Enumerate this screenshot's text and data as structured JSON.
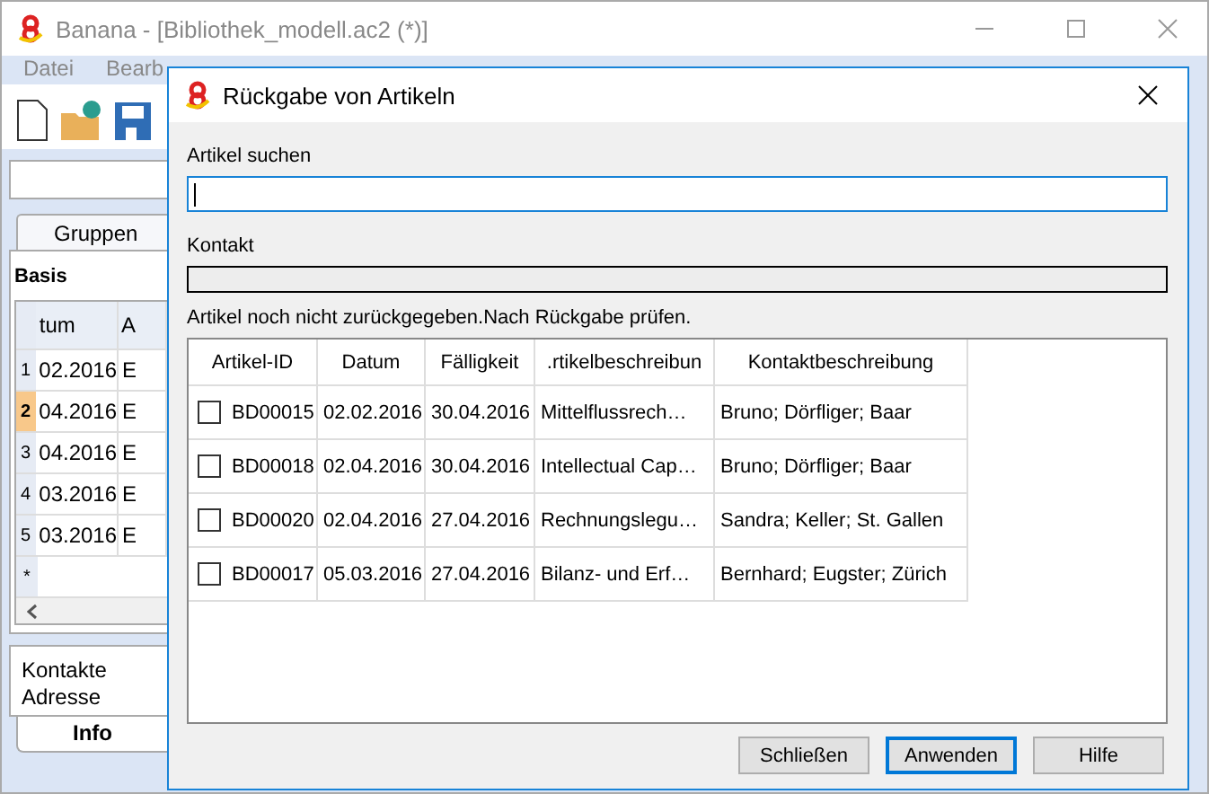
{
  "window": {
    "title": "Banana - [Bibliothek_modell.ac2 (*)]"
  },
  "menu": [
    "Datei",
    "Bearb"
  ],
  "group_tabs": [
    {
      "label": "Gruppen",
      "selected": true
    }
  ],
  "group": "Basis",
  "grid": {
    "columns": [
      "tum",
      "A"
    ],
    "new_row_marker": "*",
    "rows": [
      {
        "number": "1",
        "selected": false,
        "cells": [
          "02.2016",
          "E"
        ]
      },
      {
        "number": "2",
        "selected": true,
        "cells": [
          "04.2016",
          "E"
        ]
      },
      {
        "number": "3",
        "selected": false,
        "cells": [
          "04.2016",
          "E"
        ]
      },
      {
        "number": "4",
        "selected": false,
        "cells": [
          "03.2016",
          "E"
        ]
      },
      {
        "number": "5",
        "selected": false,
        "cells": [
          "03.2016",
          "E"
        ]
      }
    ]
  },
  "info": {
    "lines": [
      "Kontakte",
      "Adresse"
    ],
    "tabs": [
      {
        "label": "Info",
        "selected": true
      }
    ]
  },
  "dialog": {
    "title": "Rückgabe von Artikeln",
    "search": {
      "label": "Artikel suchen",
      "focused": true
    },
    "contact": {
      "label": "Kontakt"
    },
    "message": "Artikel noch nicht zurückgegeben.Nach Rückgabe prüfen.",
    "table": {
      "columns": [
        "Artikel-ID",
        "Datum",
        "Fälligkeit",
        ".rtikelbeschreibun",
        "Kontaktbeschreibung"
      ],
      "rows": [
        {
          "checked": false,
          "cells": [
            "BD00015",
            "02.02.2016",
            "30.04.2016",
            "Mittelflussrech…",
            "Bruno; Dörfliger; Baar"
          ]
        },
        {
          "checked": false,
          "cells": [
            "BD00018",
            "02.04.2016",
            "30.04.2016",
            "Intellectual Cap…",
            "Bruno; Dörfliger; Baar"
          ]
        },
        {
          "checked": false,
          "cells": [
            "BD00020",
            "02.04.2016",
            "27.04.2016",
            "Rechnungslegu…",
            "Sandra; Keller; St. Gallen"
          ]
        },
        {
          "checked": false,
          "cells": [
            "BD00017",
            "05.03.2016",
            "27.04.2016",
            "Bilanz- und Erf…",
            "Bernhard; Eugster; Zürich"
          ]
        }
      ]
    },
    "buttons": [
      {
        "label": "Schließen",
        "default": false
      },
      {
        "label": "Anwenden",
        "default": true
      },
      {
        "label": "Hilfe",
        "default": false
      }
    ]
  }
}
